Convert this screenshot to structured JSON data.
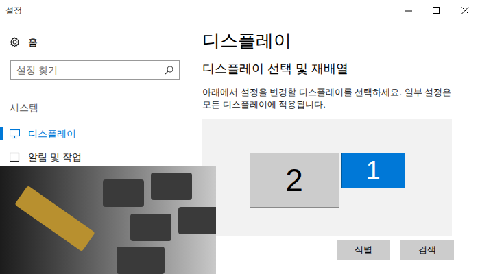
{
  "window": {
    "title": "설정"
  },
  "sidebar": {
    "home": {
      "label": "홈"
    },
    "search": {
      "placeholder": "설정 찾기"
    },
    "section": "시스템",
    "items": [
      {
        "label": "디스플레이",
        "selected": true
      },
      {
        "label": "알림 및 작업",
        "selected": false
      }
    ]
  },
  "main": {
    "title": "디스플레이",
    "subtitle": "디스플레이 선택 및 재배열",
    "description": [
      "아래에서 설정을 변경할 디스플레이를 선택하세요. 일부 설정은",
      "모든 디스플레이에 적용됩니다."
    ],
    "displays": [
      {
        "label": "2",
        "selected": false
      },
      {
        "label": "1",
        "selected": true
      }
    ],
    "buttons": [
      "식별",
      "검색"
    ]
  }
}
